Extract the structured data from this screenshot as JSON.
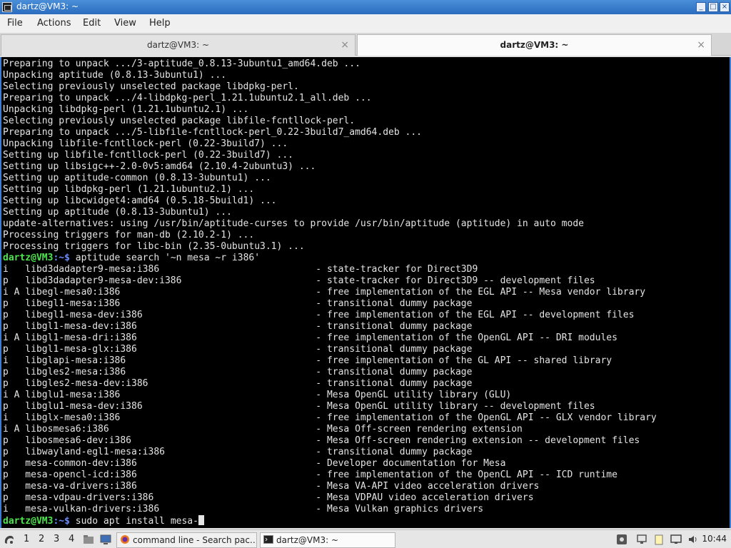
{
  "window": {
    "title": "dartz@VM3: ~",
    "controls": {
      "minimize": "_",
      "maximize": "□",
      "close": "×"
    }
  },
  "menu": [
    "File",
    "Actions",
    "Edit",
    "View",
    "Help"
  ],
  "tabs": [
    {
      "label": "dartz@VM3: ~",
      "close": "×",
      "active": false
    },
    {
      "label": "dartz@VM3: ~",
      "close": "×",
      "active": true
    }
  ],
  "terminal": {
    "prompt_user": "dartz@VM3",
    "prompt_path": ":~$",
    "output_before": [
      "Preparing to unpack .../3-aptitude_0.8.13-3ubuntu1_amd64.deb ...",
      "Unpacking aptitude (0.8.13-3ubuntu1) ...",
      "Selecting previously unselected package libdpkg-perl.",
      "Preparing to unpack .../4-libdpkg-perl_1.21.1ubuntu2.1_all.deb ...",
      "Unpacking libdpkg-perl (1.21.1ubuntu2.1) ...",
      "Selecting previously unselected package libfile-fcntllock-perl.",
      "Preparing to unpack .../5-libfile-fcntllock-perl_0.22-3build7_amd64.deb ...",
      "Unpacking libfile-fcntllock-perl (0.22-3build7) ...",
      "Setting up libfile-fcntllock-perl (0.22-3build7) ...",
      "Setting up libsigc++-2.0-0v5:amd64 (2.10.4-2ubuntu3) ...",
      "Setting up aptitude-common (0.8.13-3ubuntu1) ...",
      "Setting up libdpkg-perl (1.21.1ubuntu2.1) ...",
      "Setting up libcwidget4:amd64 (0.5.18-5build1) ...",
      "Setting up aptitude (0.8.13-3ubuntu1) ...",
      "update-alternatives: using /usr/bin/aptitude-curses to provide /usr/bin/aptitude (aptitude) in auto mode",
      "Processing triggers for man-db (2.10.2-1) ...",
      "Processing triggers for libc-bin (2.35-0ubuntu3.1) ..."
    ],
    "command1": " aptitude search '~n mesa ~r i386'",
    "results": [
      "i   libd3dadapter9-mesa:i386                            - state-tracker for Direct3D9",
      "p   libd3dadapter9-mesa-dev:i386                        - state-tracker for Direct3D9 -- development files",
      "i A libegl-mesa0:i386                                   - free implementation of the EGL API -- Mesa vendor library",
      "p   libegl1-mesa:i386                                   - transitional dummy package",
      "p   libegl1-mesa-dev:i386                               - free implementation of the EGL API -- development files",
      "p   libgl1-mesa-dev:i386                                - transitional dummy package",
      "i A libgl1-mesa-dri:i386                                - free implementation of the OpenGL API -- DRI modules",
      "p   libgl1-mesa-glx:i386                                - transitional dummy package",
      "i   libglapi-mesa:i386                                  - free implementation of the GL API -- shared library",
      "p   libgles2-mesa:i386                                  - transitional dummy package",
      "p   libgles2-mesa-dev:i386                              - transitional dummy package",
      "i A libglu1-mesa:i386                                   - Mesa OpenGL utility library (GLU)",
      "p   libglu1-mesa-dev:i386                               - Mesa OpenGL utility library -- development files",
      "i   libglx-mesa0:i386                                   - free implementation of the OpenGL API -- GLX vendor library",
      "i A libosmesa6:i386                                     - Mesa Off-screen rendering extension",
      "p   libosmesa6-dev:i386                                 - Mesa Off-screen rendering extension -- development files",
      "p   libwayland-egl1-mesa:i386                           - transitional dummy package",
      "p   mesa-common-dev:i386                                - Developer documentation for Mesa",
      "p   mesa-opencl-icd:i386                                - free implementation of the OpenCL API -- ICD runtime",
      "p   mesa-va-drivers:i386                                - Mesa VA-API video acceleration drivers",
      "p   mesa-vdpau-drivers:i386                             - Mesa VDPAU video acceleration drivers",
      "i   mesa-vulkan-drivers:i386                            - Mesa Vulkan graphics drivers"
    ],
    "command2": " sudo apt install mesa-"
  },
  "taskbar": {
    "start_icon": "lxqt-menu-icon",
    "workspaces": [
      "1",
      "2",
      "3",
      "4"
    ],
    "tasks": [
      {
        "label": "command line - Search pac…",
        "icon": "firefox-icon",
        "active": false
      },
      {
        "label": "dartz@VM3: ~",
        "icon": "terminal-icon",
        "active": true
      }
    ],
    "clock": "10:44"
  }
}
